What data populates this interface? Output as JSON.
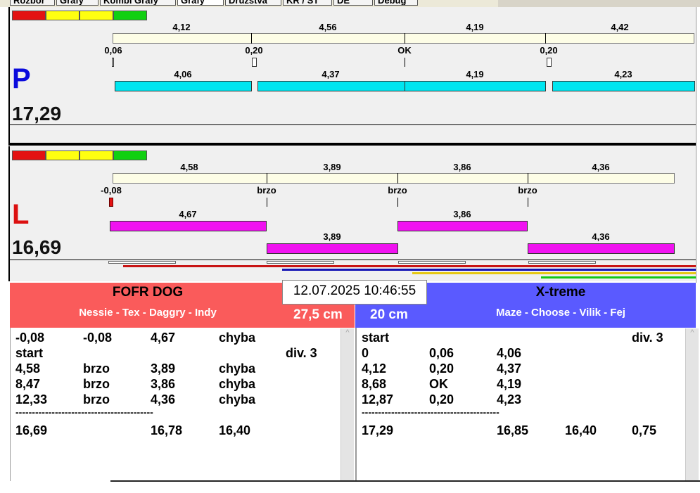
{
  "tabs": [
    {
      "label": "Rozbor",
      "active": false
    },
    {
      "label": "Grafy",
      "active": false
    },
    {
      "label": "Kombi Grafy",
      "active": false
    },
    {
      "label": "Grafy",
      "active": true
    },
    {
      "label": "Družstva",
      "active": false
    },
    {
      "label": "KR / ST",
      "active": false
    },
    {
      "label": "DE",
      "active": false
    },
    {
      "label": "Debug",
      "active": false
    }
  ],
  "lane_p": {
    "side": "P",
    "side_color": "#0a0adc",
    "total": "17,29",
    "ruler_labels": [
      "4,12",
      "4,56",
      "4,19",
      "4,42"
    ],
    "reaction_labels": [
      "0,06",
      "0,20",
      "OK",
      "0,20"
    ],
    "run_labels": [
      "4,06",
      "4,37",
      "4,19",
      "4,23"
    ]
  },
  "lane_l": {
    "side": "L",
    "side_color": "#dc1010",
    "total": "16,69",
    "ruler_labels": [
      "4,58",
      "3,89",
      "3,86",
      "4,36"
    ],
    "reaction_labels": [
      "-0,08",
      "brzo",
      "brzo",
      "brzo"
    ],
    "run_labels_top": [
      "4,67",
      "3,86"
    ],
    "run_labels_bottom": [
      "3,89",
      "4,36"
    ]
  },
  "datetime": "12.07.2025 10:46:55",
  "left_team": {
    "name": "FOFR DOG",
    "members": "Nessie - Tex - Daggry - Indy",
    "height": "27,5 cm",
    "color": "#fa5b5b",
    "rows": [
      [
        "-0,08",
        "-0,08",
        "4,67",
        "chyba",
        ""
      ],
      [
        "start",
        "",
        "",
        "",
        "div.  3"
      ],
      [
        "4,58",
        "brzo",
        "3,89",
        "chyba",
        ""
      ],
      [
        "8,47",
        "brzo",
        "3,86",
        "chyba",
        ""
      ],
      [
        "12,33",
        "brzo",
        "4,36",
        "chyba",
        ""
      ]
    ],
    "separator": "------------------------------------------",
    "summary": [
      "16,69",
      "",
      "16,78",
      "16,40",
      ""
    ]
  },
  "right_team": {
    "name": "X-treme",
    "members": "Maze - Choose - Vilik - Fej",
    "height": "20 cm",
    "color": "#5a5aff",
    "rows": [
      [
        "start",
        "",
        "",
        "",
        "div.  3"
      ],
      [
        "0",
        "0,06",
        "4,06",
        "",
        ""
      ],
      [
        "4,12",
        "0,20",
        "4,37",
        "",
        ""
      ],
      [
        "8,68",
        "OK",
        "4,19",
        "",
        ""
      ],
      [
        "12,87",
        "0,20",
        "4,23",
        "",
        ""
      ]
    ],
    "separator": "------------------------------------------",
    "summary": [
      "17,29",
      "",
      "16,85",
      "16,40",
      "0,75"
    ]
  },
  "icons": {
    "scroll_up": "scroll-up-arrow"
  }
}
